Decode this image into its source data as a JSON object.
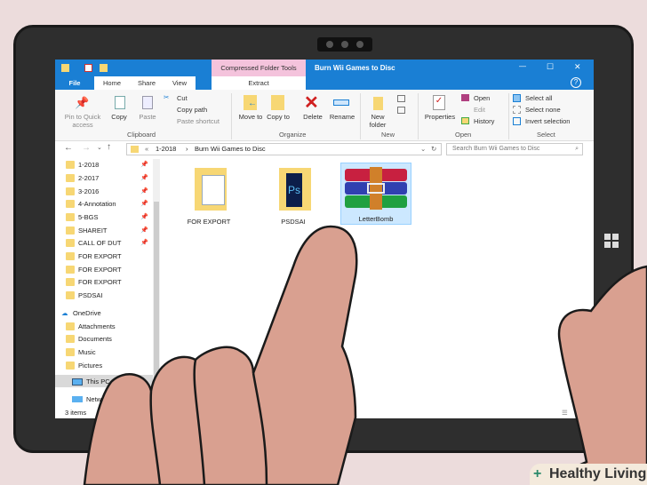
{
  "window": {
    "title": "Burn Wii Games to Disc",
    "context_tab": "Compressed Folder Tools",
    "controls": {
      "minimize": "—",
      "maximize": "☐",
      "close": "✕"
    }
  },
  "tabs": [
    "File",
    "Home",
    "Share",
    "View",
    "Extract"
  ],
  "ribbon": {
    "clipboard": {
      "pin": "Pin to Quick access",
      "copy": "Copy",
      "paste": "Paste",
      "cut": "Cut",
      "copy_path": "Copy path",
      "paste_shortcut": "Paste shortcut",
      "label": "Clipboard"
    },
    "organize": {
      "move_to": "Move to",
      "copy_to": "Copy to",
      "delete": "Delete",
      "rename": "Rename",
      "label": "Organize"
    },
    "new": {
      "new_folder": "New folder",
      "label": "New"
    },
    "open": {
      "properties": "Properties",
      "open": "Open",
      "edit": "Edit",
      "history": "History",
      "label": "Open"
    },
    "select": {
      "select_all": "Select all",
      "select_none": "Select none",
      "invert": "Invert selection",
      "label": "Select"
    }
  },
  "address": {
    "prefix": "«",
    "crumbs": [
      "1-2018",
      "Burn Wii Games to Disc"
    ],
    "sep": "›",
    "search_placeholder": "Search Burn Wii Games to Disc"
  },
  "nav": {
    "quick": [
      "1-2018",
      "2-2017",
      "3-2016",
      "4-Annotation",
      "5-BGS",
      "SHAREIT",
      "CALL OF DUT",
      "FOR EXPORT",
      "FOR EXPORT",
      "FOR EXPORT",
      "PSDSAI"
    ],
    "onedrive": "OneDrive",
    "onedrive_items": [
      "Attachments",
      "Documents",
      "Music",
      "Pictures"
    ],
    "this_pc": "This PC",
    "network": "Network"
  },
  "files": [
    {
      "name": "FOR EXPORT"
    },
    {
      "name": "PSDSAI"
    },
    {
      "name": "LetterBomb",
      "selected": true
    }
  ],
  "status": {
    "count": "3 items"
  },
  "watermark": "Healthy Living",
  "colors": {
    "titlebar": "#1a7fd4",
    "selection": "#cce8ff",
    "folder": "#f7d774"
  }
}
